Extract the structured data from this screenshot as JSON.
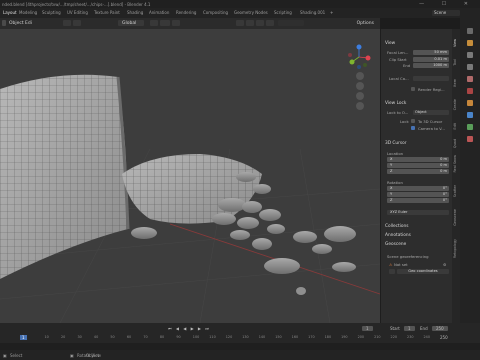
{
  "window": {
    "title": "nded.blend [4thprojects/tvw/.../tmp/sheet/.../chips-...].blend] - Blender 4.1",
    "controls": "— ☐ ✕"
  },
  "workspace_tabs": [
    {
      "label": "Layout",
      "active": true
    },
    {
      "label": "Modeling"
    },
    {
      "label": "Sculpting"
    },
    {
      "label": "UV Editing"
    },
    {
      "label": "Texture Paint"
    },
    {
      "label": "Shading"
    },
    {
      "label": "Animation"
    },
    {
      "label": "Rendering"
    },
    {
      "label": "Compositing"
    },
    {
      "label": "Geometry Nodes"
    },
    {
      "label": "Scripting"
    },
    {
      "label": "Shading.001"
    }
  ],
  "scene_field": "Scene",
  "viewport_header": {
    "object": "Object",
    "edit": "Edi",
    "transform": "Global",
    "options": "Options"
  },
  "npanel": {
    "view_header": "View",
    "focal_length_label": "Focal Len...",
    "focal_length_value": "50 mm",
    "clip_start_label": "Clip Start",
    "clip_start_value": "0.01 m",
    "clip_end_label": "End",
    "clip_end_value": "1000 m",
    "local_camera_label": "Local Ca...",
    "render_region_label": "Render Regi...",
    "view_lock_header": "View Lock",
    "lock_to_object_label": "Lock to O...",
    "lock_to_object_value": "Object",
    "lock_label": "Lock",
    "to_3d_cursor_label": "To 3D Cursor",
    "camera_to_view_label": "Camera to V...",
    "cursor_header": "3D Cursor",
    "location_label": "Location",
    "location": [
      {
        "axis": "X",
        "value": "0 m"
      },
      {
        "axis": "Y",
        "value": "0 m"
      },
      {
        "axis": "Z",
        "value": "0 m"
      }
    ],
    "rotation_label": "Rotation",
    "rotation": [
      {
        "axis": "X",
        "value": "0°"
      },
      {
        "axis": "Y",
        "value": "0°"
      },
      {
        "axis": "Z",
        "value": "0°"
      }
    ],
    "rotation_mode": "XYZ Euler",
    "collections_header": "Collections",
    "annotations_header": "Annotations",
    "geoscene_header": "Geoscene",
    "georef_label": "Scene georeferencing",
    "not_set_label": "Not set",
    "geo_coords_button": "Geo coordinates"
  },
  "sidebar_tabs": [
    "View",
    "Tool",
    "Item",
    "Create",
    "Edit",
    "Quad",
    "Real Snow",
    "Scatter",
    "Geoscene",
    "Retopology"
  ],
  "timeline": {
    "frame_current": "1",
    "start_label": "Start",
    "start_value": "1",
    "end_label": "End",
    "end_value": "250",
    "ruler": [
      "0",
      "10",
      "20",
      "30",
      "40",
      "50",
      "60",
      "70",
      "80",
      "90",
      "100",
      "110",
      "120",
      "130",
      "140",
      "150",
      "160",
      "170",
      "180",
      "190",
      "200",
      "210",
      "220",
      "230",
      "240",
      "250"
    ],
    "ruler_end": "250"
  },
  "statusbar": {
    "select": "Select",
    "rotate": "Rotate View",
    "object": "Object"
  },
  "colors": {
    "accent": "#4772b3",
    "viewport_bg": "#3d3d3d",
    "panel_bg": "#2d2d2d",
    "axis_x": "#e0434f",
    "axis_y": "#7fb52f",
    "axis_z": "#3d7ee0"
  }
}
